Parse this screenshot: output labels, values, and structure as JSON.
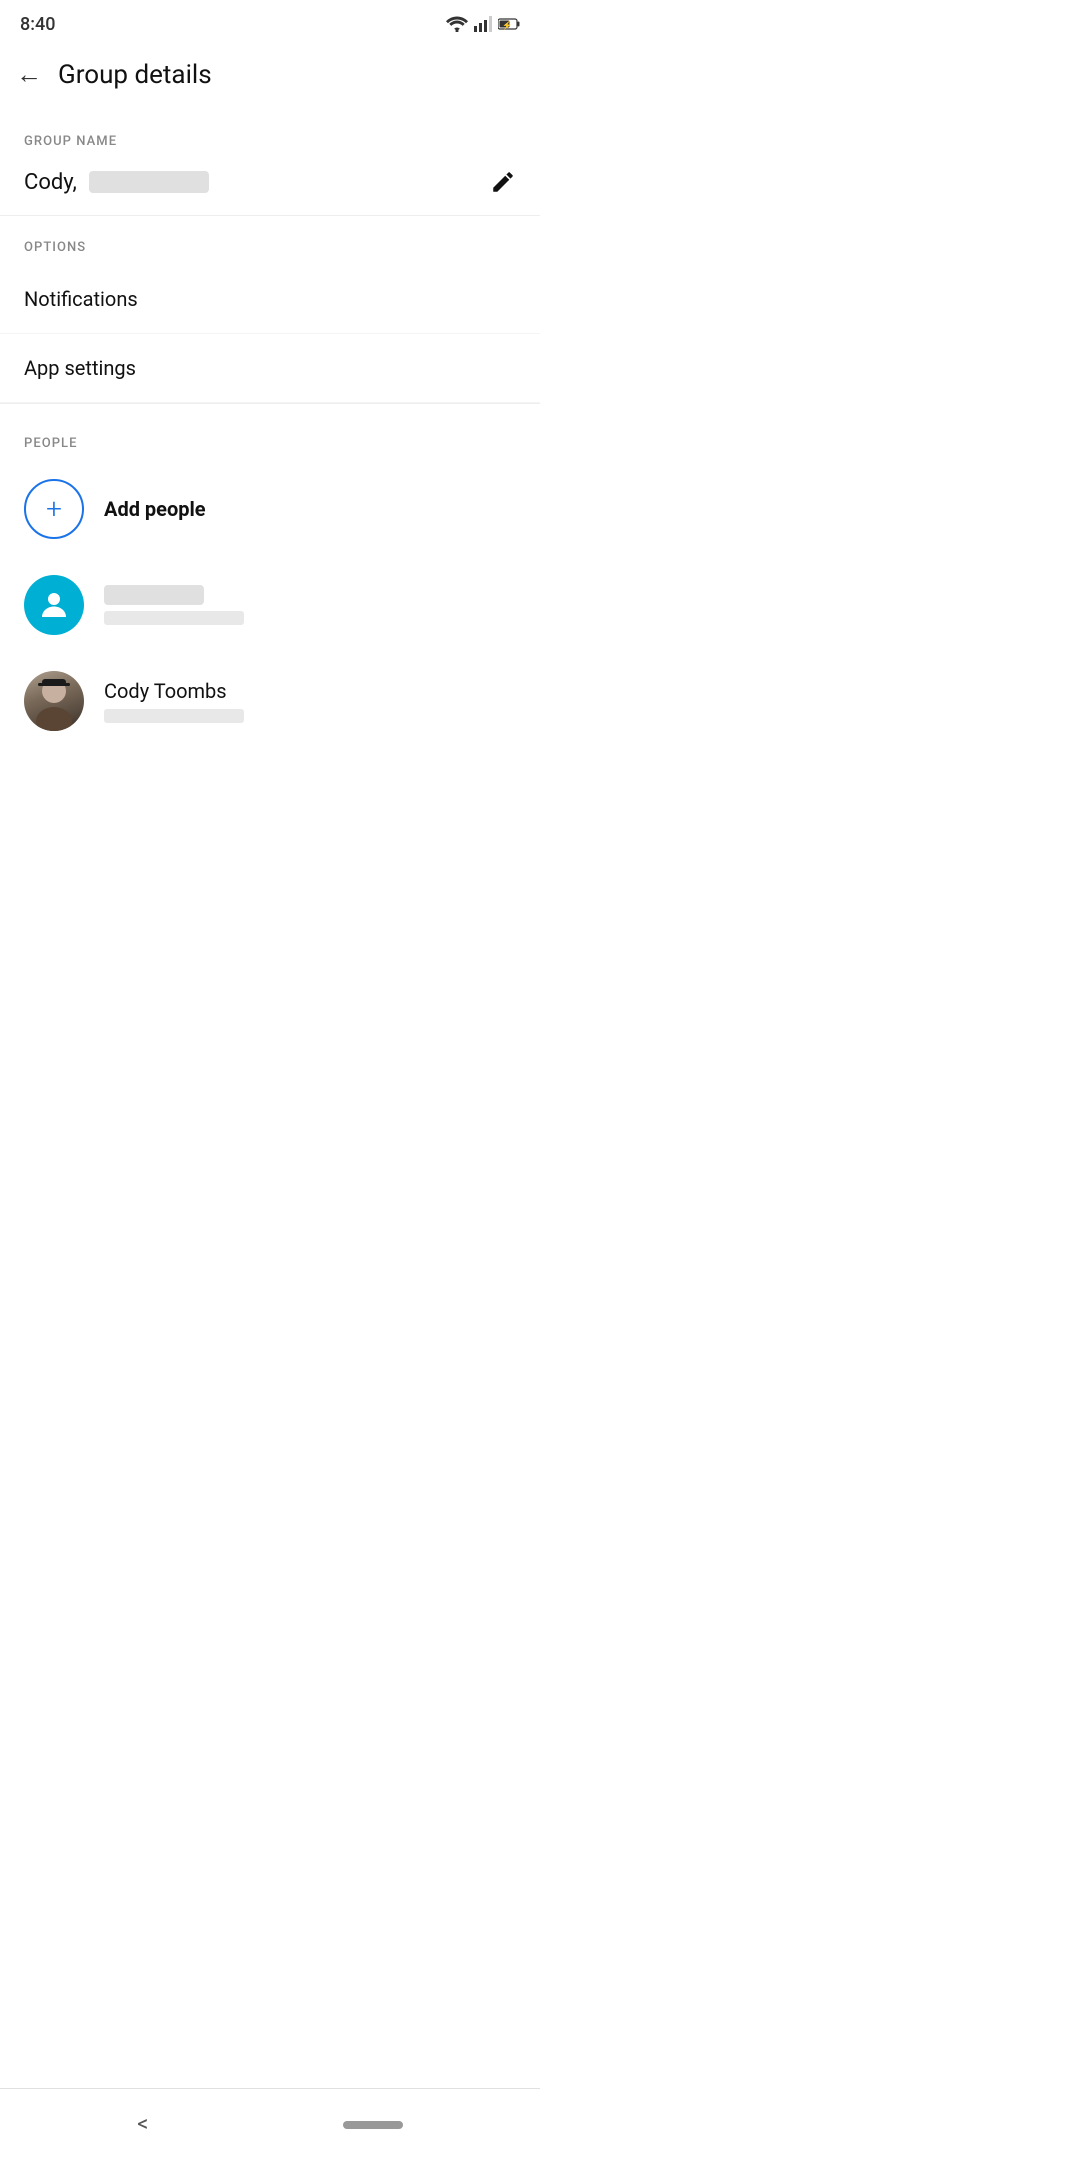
{
  "statusBar": {
    "time": "8:40"
  },
  "header": {
    "back_label": "←",
    "title": "Group details"
  },
  "groupName": {
    "section_label": "GROUP NAME",
    "name_prefix": "Cody,",
    "edit_icon": "✏"
  },
  "options": {
    "section_label": "OPTIONS",
    "items": [
      {
        "label": "Notifications"
      },
      {
        "label": "App settings"
      }
    ]
  },
  "people": {
    "section_label": "PEOPLE",
    "add_label": "Add people",
    "members": [
      {
        "id": "person1",
        "name": "Cody Toombs",
        "type": "photo"
      },
      {
        "id": "person2",
        "name": "",
        "type": "teal"
      }
    ]
  },
  "bottomNav": {
    "back_label": "<"
  }
}
